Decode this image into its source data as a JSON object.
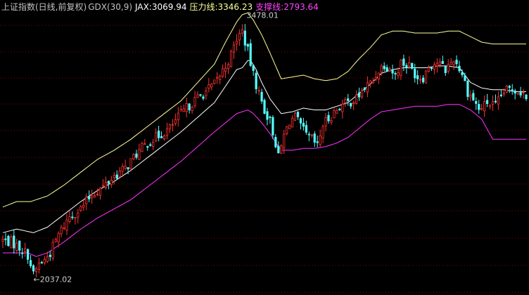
{
  "legend": {
    "title": "上证指数(日线,前复权)",
    "indicator": "GDX(30,9)",
    "jax_label": "JAX:",
    "jax_value": "3069.94",
    "resistance_label": "压力线:",
    "resistance_value": "3346.23",
    "support_label": "支撑线:",
    "support_value": "2793.64"
  },
  "colors": {
    "background": "#000000",
    "text": "#c0c0c0",
    "grid": "#8b0000",
    "resistance": "#ffff99",
    "jax": "#ffffff",
    "support": "#ff33ff",
    "candle_up": "#ff3232",
    "candle_down": "#54ffff",
    "annotation": "#d0d0d0"
  },
  "chart_data": {
    "type": "candlestick",
    "ylim": [
      1950,
      3560
    ],
    "grid": "dashed horizontal",
    "annotations": [
      {
        "text": "3478.01",
        "kind": "high",
        "x": 86,
        "y": 3478.01
      },
      {
        "text": "←2037.02",
        "kind": "low",
        "x": 11,
        "y": 2037.02
      }
    ],
    "anchors": {
      "close": [
        [
          0,
          2250
        ],
        [
          3,
          2240
        ],
        [
          6,
          2210
        ],
        [
          9,
          2170
        ],
        [
          11,
          2060
        ],
        [
          13,
          2120
        ],
        [
          15,
          2140
        ],
        [
          17,
          2180
        ],
        [
          20,
          2280
        ],
        [
          24,
          2380
        ],
        [
          28,
          2420
        ],
        [
          32,
          2500
        ],
        [
          36,
          2540
        ],
        [
          40,
          2600
        ],
        [
          44,
          2640
        ],
        [
          48,
          2720
        ],
        [
          52,
          2780
        ],
        [
          56,
          2820
        ],
        [
          60,
          2860
        ],
        [
          64,
          2940
        ],
        [
          68,
          3000
        ],
        [
          72,
          3050
        ],
        [
          76,
          3100
        ],
        [
          80,
          3200
        ],
        [
          82,
          3260
        ],
        [
          84,
          3350
        ],
        [
          86,
          3390
        ],
        [
          88,
          3280
        ],
        [
          90,
          3150
        ],
        [
          92,
          3050
        ],
        [
          94,
          2960
        ],
        [
          96,
          2900
        ],
        [
          98,
          2780
        ],
        [
          99,
          2700
        ],
        [
          101,
          2820
        ],
        [
          103,
          2900
        ],
        [
          105,
          2920
        ],
        [
          107,
          2870
        ],
        [
          109,
          2820
        ],
        [
          111,
          2800
        ],
        [
          113,
          2760
        ],
        [
          115,
          2880
        ],
        [
          118,
          2930
        ],
        [
          121,
          2980
        ],
        [
          124,
          3000
        ],
        [
          127,
          3020
        ],
        [
          130,
          3080
        ],
        [
          133,
          3120
        ],
        [
          135,
          3180
        ],
        [
          137,
          3210
        ],
        [
          139,
          3190
        ],
        [
          141,
          3150
        ],
        [
          143,
          3220
        ],
        [
          146,
          3200
        ],
        [
          149,
          3140
        ],
        [
          151,
          3140
        ],
        [
          153,
          3200
        ],
        [
          156,
          3220
        ],
        [
          159,
          3180
        ],
        [
          162,
          3240
        ],
        [
          165,
          3160
        ],
        [
          167,
          3060
        ],
        [
          169,
          3020
        ],
        [
          171,
          2960
        ],
        [
          174,
          3000
        ],
        [
          177,
          2980
        ],
        [
          180,
          3060
        ],
        [
          183,
          3080
        ],
        [
          186,
          3060
        ],
        [
          188,
          3040
        ]
      ]
    },
    "bands": {
      "jax": [
        [
          0,
          2290
        ],
        [
          5,
          2310
        ],
        [
          11,
          2290
        ],
        [
          16,
          2320
        ],
        [
          22,
          2390
        ],
        [
          28,
          2460
        ],
        [
          34,
          2520
        ],
        [
          40,
          2570
        ],
        [
          46,
          2630
        ],
        [
          52,
          2700
        ],
        [
          58,
          2770
        ],
        [
          64,
          2840
        ],
        [
          70,
          2920
        ],
        [
          76,
          3000
        ],
        [
          80,
          3090
        ],
        [
          84,
          3180
        ],
        [
          86,
          3190
        ],
        [
          88,
          3230
        ],
        [
          89,
          3230
        ],
        [
          91,
          3180
        ],
        [
          93,
          3110
        ],
        [
          96,
          3020
        ],
        [
          100,
          2940
        ],
        [
          104,
          2950
        ],
        [
          108,
          2970
        ],
        [
          112,
          2960
        ],
        [
          116,
          2960
        ],
        [
          120,
          2980
        ],
        [
          124,
          3000
        ],
        [
          128,
          3050
        ],
        [
          132,
          3100
        ],
        [
          136,
          3160
        ],
        [
          140,
          3180
        ],
        [
          144,
          3190
        ],
        [
          148,
          3190
        ],
        [
          152,
          3190
        ],
        [
          156,
          3200
        ],
        [
          160,
          3200
        ],
        [
          164,
          3190
        ],
        [
          168,
          3110
        ],
        [
          172,
          3080
        ],
        [
          176,
          3070
        ],
        [
          180,
          3070
        ],
        [
          184,
          3060
        ],
        [
          188,
          3060
        ]
      ],
      "resistance": [
        [
          0,
          2430
        ],
        [
          5,
          2460
        ],
        [
          10,
          2460
        ],
        [
          16,
          2490
        ],
        [
          22,
          2550
        ],
        [
          28,
          2620
        ],
        [
          34,
          2690
        ],
        [
          40,
          2740
        ],
        [
          46,
          2800
        ],
        [
          52,
          2870
        ],
        [
          58,
          2940
        ],
        [
          64,
          3010
        ],
        [
          70,
          3110
        ],
        [
          76,
          3210
        ],
        [
          80,
          3330
        ],
        [
          84,
          3440
        ],
        [
          86,
          3480
        ],
        [
          88,
          3490
        ],
        [
          90,
          3450
        ],
        [
          93,
          3370
        ],
        [
          96,
          3270
        ],
        [
          100,
          3130
        ],
        [
          104,
          3140
        ],
        [
          108,
          3150
        ],
        [
          112,
          3130
        ],
        [
          116,
          3120
        ],
        [
          120,
          3130
        ],
        [
          124,
          3170
        ],
        [
          128,
          3240
        ],
        [
          132,
          3300
        ],
        [
          136,
          3370
        ],
        [
          140,
          3390
        ],
        [
          144,
          3390
        ],
        [
          148,
          3380
        ],
        [
          152,
          3380
        ],
        [
          156,
          3380
        ],
        [
          160,
          3390
        ],
        [
          164,
          3390
        ],
        [
          168,
          3360
        ],
        [
          172,
          3330
        ],
        [
          176,
          3320
        ],
        [
          180,
          3320
        ],
        [
          184,
          3320
        ],
        [
          188,
          3320
        ]
      ],
      "support": [
        [
          0,
          2180
        ],
        [
          5,
          2180
        ],
        [
          9,
          2180
        ],
        [
          12,
          2160
        ],
        [
          16,
          2180
        ],
        [
          22,
          2240
        ],
        [
          28,
          2310
        ],
        [
          34,
          2370
        ],
        [
          40,
          2420
        ],
        [
          46,
          2470
        ],
        [
          52,
          2540
        ],
        [
          58,
          2610
        ],
        [
          64,
          2680
        ],
        [
          70,
          2760
        ],
        [
          76,
          2840
        ],
        [
          80,
          2890
        ],
        [
          84,
          2940
        ],
        [
          86,
          2950
        ],
        [
          88,
          2960
        ],
        [
          90,
          2940
        ],
        [
          93,
          2890
        ],
        [
          96,
          2830
        ],
        [
          99,
          2760
        ],
        [
          100,
          2740
        ],
        [
          104,
          2740
        ],
        [
          108,
          2750
        ],
        [
          112,
          2750
        ],
        [
          116,
          2760
        ],
        [
          120,
          2780
        ],
        [
          124,
          2810
        ],
        [
          128,
          2860
        ],
        [
          132,
          2910
        ],
        [
          136,
          2950
        ],
        [
          140,
          2960
        ],
        [
          144,
          2970
        ],
        [
          148,
          2980
        ],
        [
          152,
          2980
        ],
        [
          156,
          2980
        ],
        [
          160,
          2990
        ],
        [
          164,
          2990
        ],
        [
          168,
          2960
        ],
        [
          172,
          2910
        ],
        [
          176,
          2800
        ],
        [
          180,
          2800
        ],
        [
          184,
          2800
        ],
        [
          188,
          2800
        ]
      ]
    }
  }
}
